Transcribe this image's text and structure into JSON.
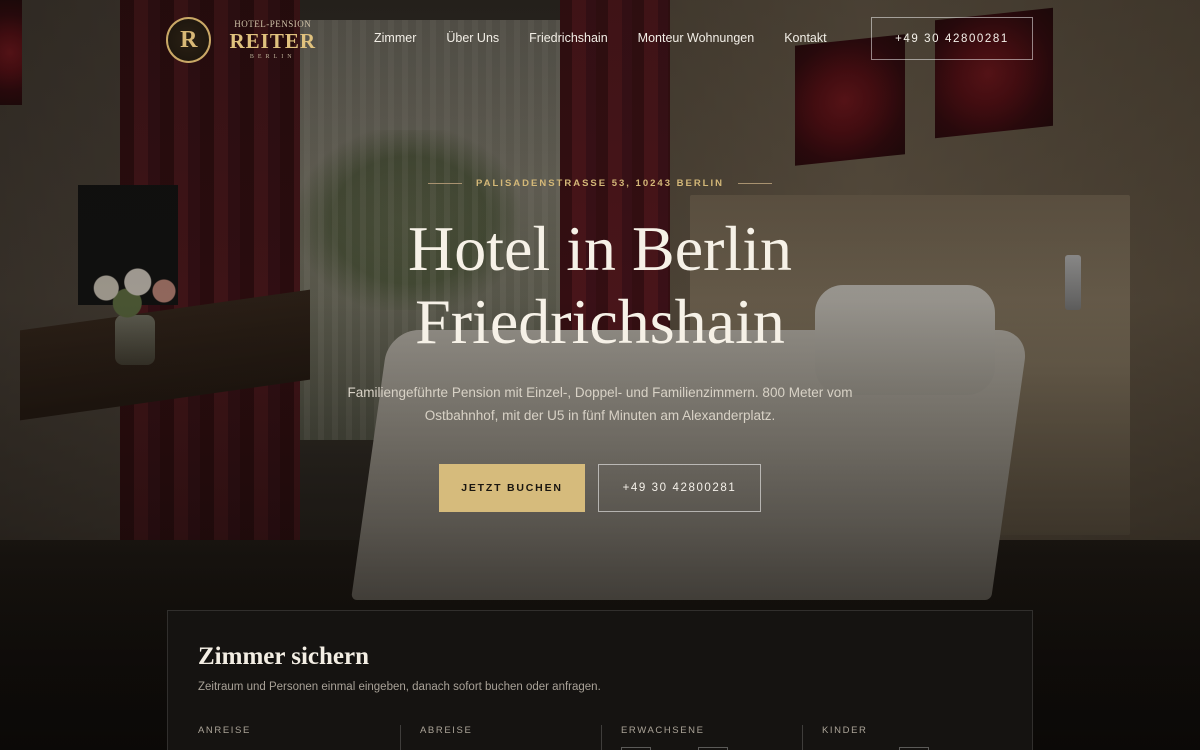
{
  "header": {
    "logo": {
      "emblem_letter": "R",
      "top_text": "HOTEL-PENSION",
      "name": "REITER",
      "city": "BERLIN"
    },
    "nav": [
      {
        "label": "Zimmer"
      },
      {
        "label": "Über Uns"
      },
      {
        "label": "Friedrichshain"
      },
      {
        "label": "Monteur Wohnungen"
      },
      {
        "label": "Kontakt"
      }
    ],
    "phone": "+49 30 42800281"
  },
  "hero": {
    "address": "PALISADENSTRASSE 53, 10243 BERLIN",
    "title_line1": "Hotel in Berlin",
    "title_line2": "Friedrichshain",
    "subtitle": "Familiengeführte Pension mit Einzel-, Doppel- und Familienzimmern. 800 Meter vom Ostbahnhof, mit der U5 in fünf Minuten am Alexanderplatz.",
    "book_button": "JETZT BUCHEN",
    "call_button": "+49 30 42800281"
  },
  "booking": {
    "title": "Zimmer sichern",
    "description": "Zeitraum und Personen einmal eingeben, danach sofort buchen oder anfragen.",
    "fields": {
      "arrival": "ANREISE",
      "departure": "ABREISE",
      "adults": "ERWACHSENE",
      "children": "KINDER"
    }
  },
  "colors": {
    "accent_gold": "#d6bb7c",
    "background_dark": "#141210",
    "curtain_red": "#5a1a20"
  }
}
